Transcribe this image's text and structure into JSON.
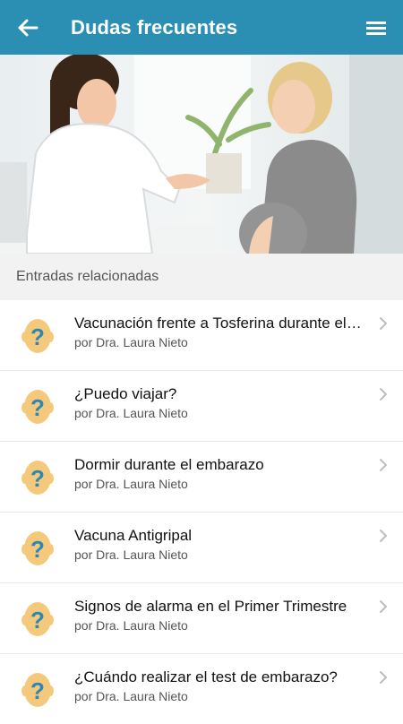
{
  "header": {
    "title": "Dudas frecuentes",
    "back_icon": "arrow-left-icon",
    "menu_icon": "hamburger-menu-icon",
    "color": "#2b8fb3"
  },
  "hero": {
    "image_subject": "doctor-and-pregnant-woman-photo"
  },
  "section": {
    "title": "Entradas relacionadas"
  },
  "entries": [
    {
      "title": "Vacunación frente a Tosferina durante el embarazo",
      "author": "por Dra. Laura Nieto"
    },
    {
      "title": "¿Puedo viajar?",
      "author": "por Dra. Laura Nieto"
    },
    {
      "title": "Dormir durante el embarazo",
      "author": "por Dra. Laura Nieto"
    },
    {
      "title": "Vacuna Antigripal",
      "author": "por Dra. Laura Nieto"
    },
    {
      "title": "Signos de alarma en el Primer Trimestre",
      "author": "por Dra. Laura Nieto"
    },
    {
      "title": "¿Cuándo realizar el test de embarazo?",
      "author": "por Dra. Laura Nieto"
    }
  ],
  "colors": {
    "avatar_fill": "#f5c97c",
    "question_mark": "#2e86b3",
    "chevron": "#bdbdbd"
  }
}
